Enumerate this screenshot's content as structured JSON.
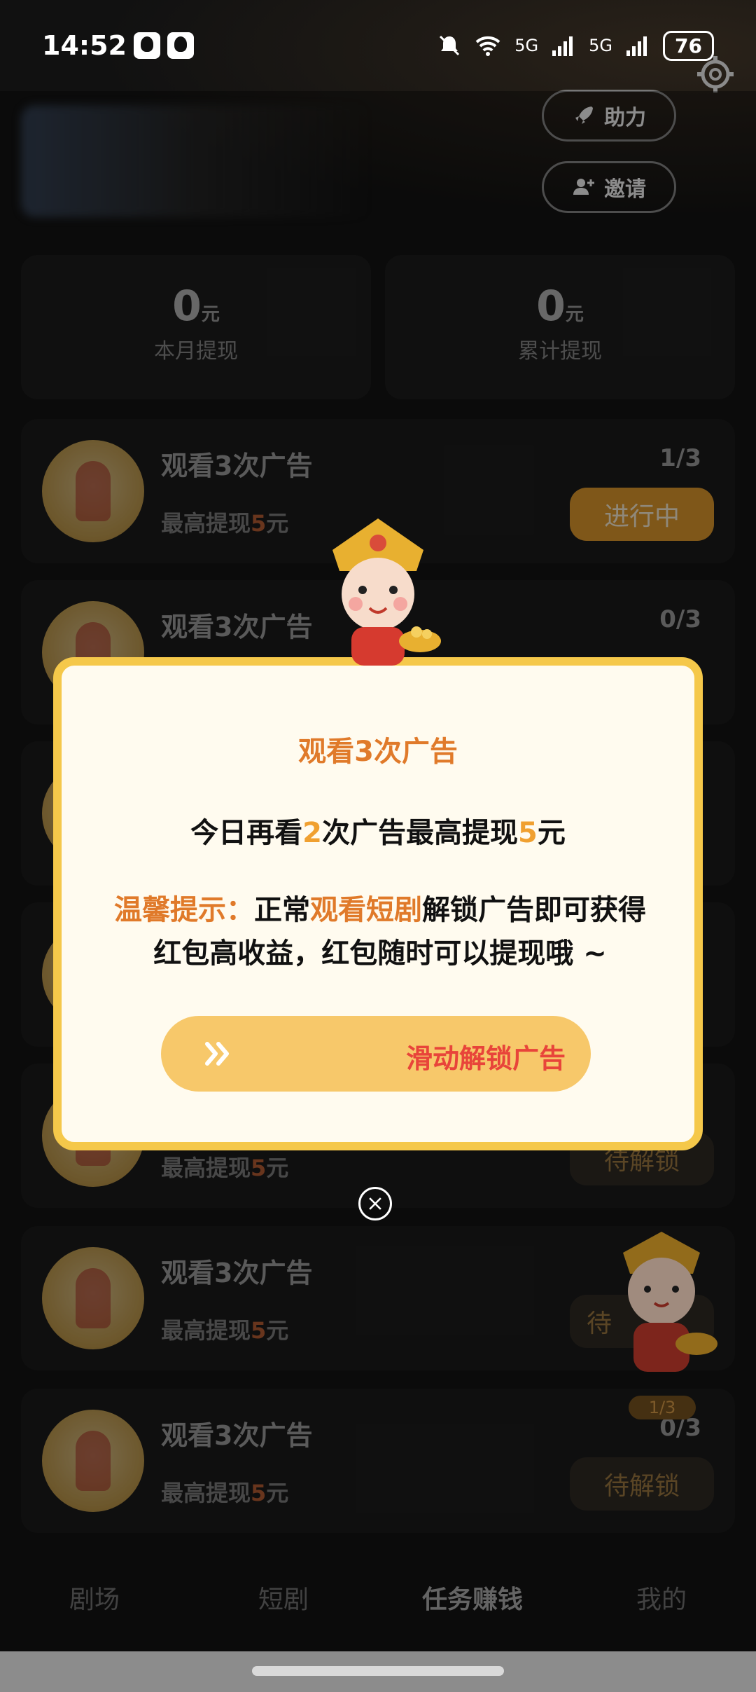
{
  "status_bar": {
    "time": "14:52",
    "network1": "5G",
    "network2": "5G",
    "battery": "76"
  },
  "header": {
    "help_label": "助力",
    "invite_label": "邀请"
  },
  "stats": [
    {
      "value": "0",
      "unit": "元",
      "label": "本月提现"
    },
    {
      "value": "0",
      "unit": "元",
      "label": "累计提现"
    }
  ],
  "tasks": [
    {
      "title": "观看3次广告",
      "sub_prefix": "最高提现",
      "sub_amount": "5",
      "sub_suffix": "元",
      "count": "1/3",
      "button": "进行中"
    },
    {
      "title": "观看3次广告",
      "count": "0/3"
    },
    {
      "sub_prefix": "最高提现",
      "sub_amount": "5",
      "sub_suffix": "元",
      "button": "待解锁"
    },
    {
      "title": "观看3次广告",
      "sub_prefix": "最高提现",
      "sub_amount": "5",
      "sub_suffix": "元",
      "button": "待"
    },
    {
      "title": "观看3次广告",
      "sub_prefix": "最高提现",
      "sub_amount": "5",
      "sub_suffix": "元",
      "count": "0/3",
      "button": "待解锁"
    }
  ],
  "float_badge": "1/3",
  "modal": {
    "title": "观看3次广告",
    "line1_a": "今日再看",
    "line1_num1": "2",
    "line1_b": "次广告最高提现",
    "line1_num2": "5",
    "line1_c": "元",
    "tip_label": "温馨提示：",
    "tip_a": "正常",
    "tip_highlight": "观看短剧",
    "tip_b": "解锁广告即可获得红包高收益，红包随时可以提现哦 ~",
    "slide_label": "滑动解锁广告"
  },
  "tab_bar": [
    {
      "label": "剧场"
    },
    {
      "label": "短剧"
    },
    {
      "label": "任务赚钱",
      "active": true
    },
    {
      "label": "我的"
    }
  ],
  "colors": {
    "accent": "#e07a2a",
    "modal_border": "#f5c84a",
    "slide_bg": "#f7c86a",
    "slide_text": "#e8443a"
  }
}
